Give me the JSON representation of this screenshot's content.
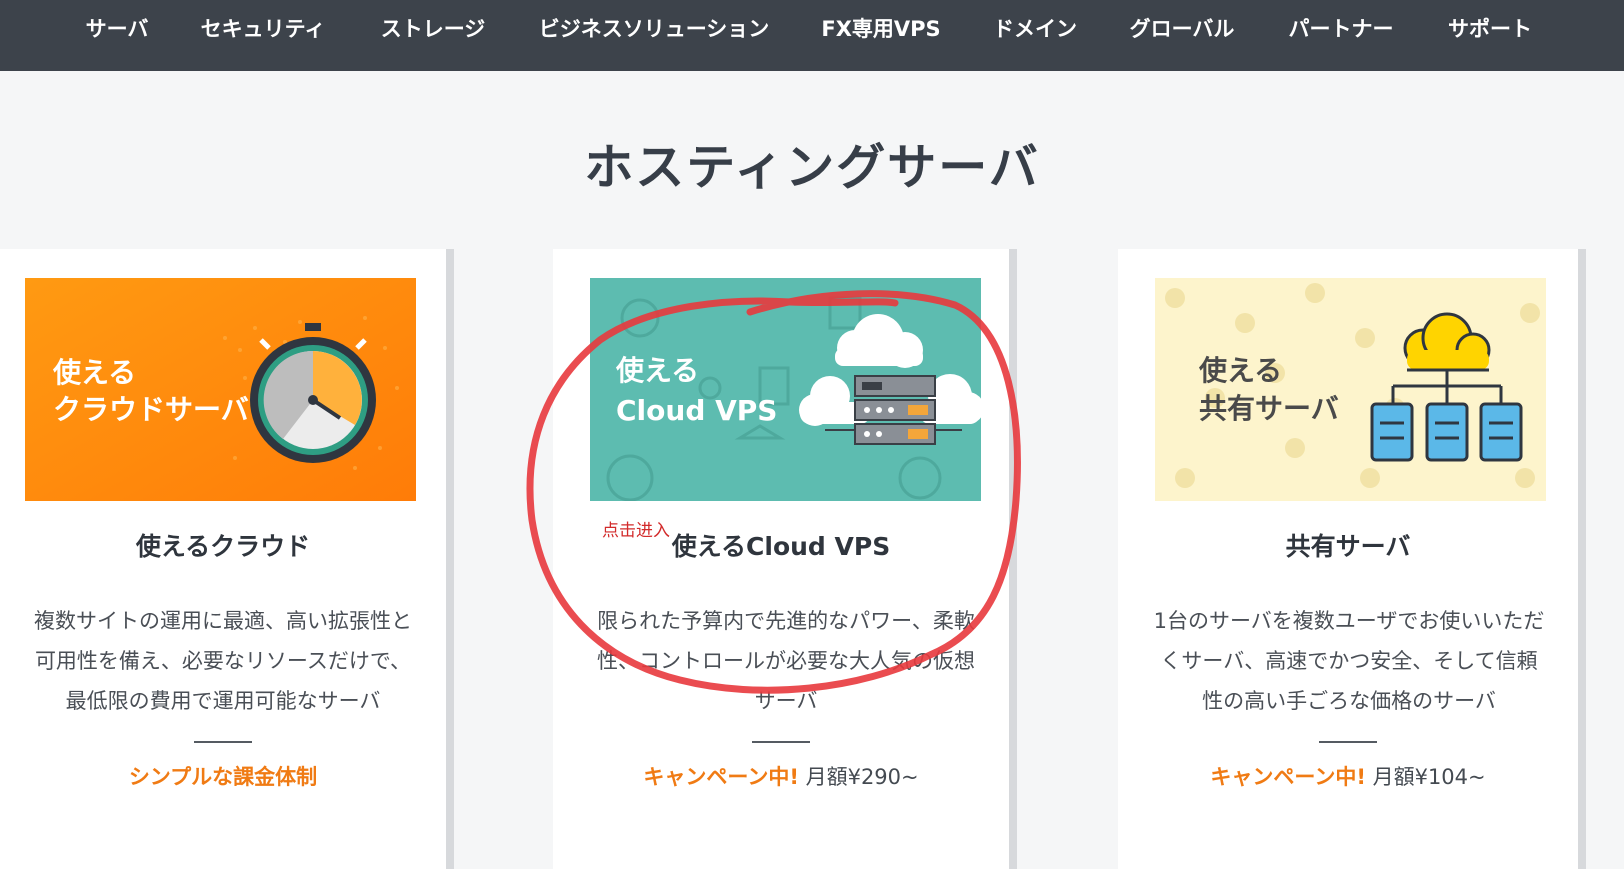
{
  "nav": {
    "items": [
      "サーバ",
      "セキュリティ",
      "ストレージ",
      "ビジネスソリューション",
      "FX専用VPS",
      "ドメイン",
      "グローバル",
      "パートナー",
      "サポート"
    ]
  },
  "page": {
    "title": "ホスティングサーバ"
  },
  "cards": [
    {
      "banner_line1": "使える",
      "banner_line2": "クラウドサーバ",
      "title": "使えるクラウド",
      "description": "複数サイトの運用に最適、高い拡張性と可用性を備え、必要なリソースだけで、最低限の費用で運用可能なサーバ",
      "promo": "シンプルな課金体制",
      "price": ""
    },
    {
      "banner_line1": "使える",
      "banner_line2": "Cloud VPS",
      "title": "使えるCloud VPS",
      "description": "限られた予算内で先進的なパワー、柔軟性、コントロールが必要な大人気の仮想サーバ",
      "promo": "キャンペーン中!",
      "price": " 月額¥290~"
    },
    {
      "banner_line1": "使える",
      "banner_line2": "共有サーバ",
      "title": "共有サーバ",
      "description": "1台のサーバを複数ユーザでお使いいただくサーバ、高速でかつ安全、そして信頼性の高い手ごろな価格のサーバ",
      "promo": "キャンペーン中!",
      "price": " 月額¥104~"
    }
  ],
  "annotation": {
    "text": "点击进入"
  },
  "colors": {
    "nav_bg": "#3d434b",
    "accent_orange": "#f07b14",
    "teal": "#5dbcb0",
    "annotation_red": "#e8383d"
  },
  "icons": [
    "stopwatch-icon",
    "server-rack-icon",
    "cloud-icon",
    "cloud-network-icon"
  ]
}
